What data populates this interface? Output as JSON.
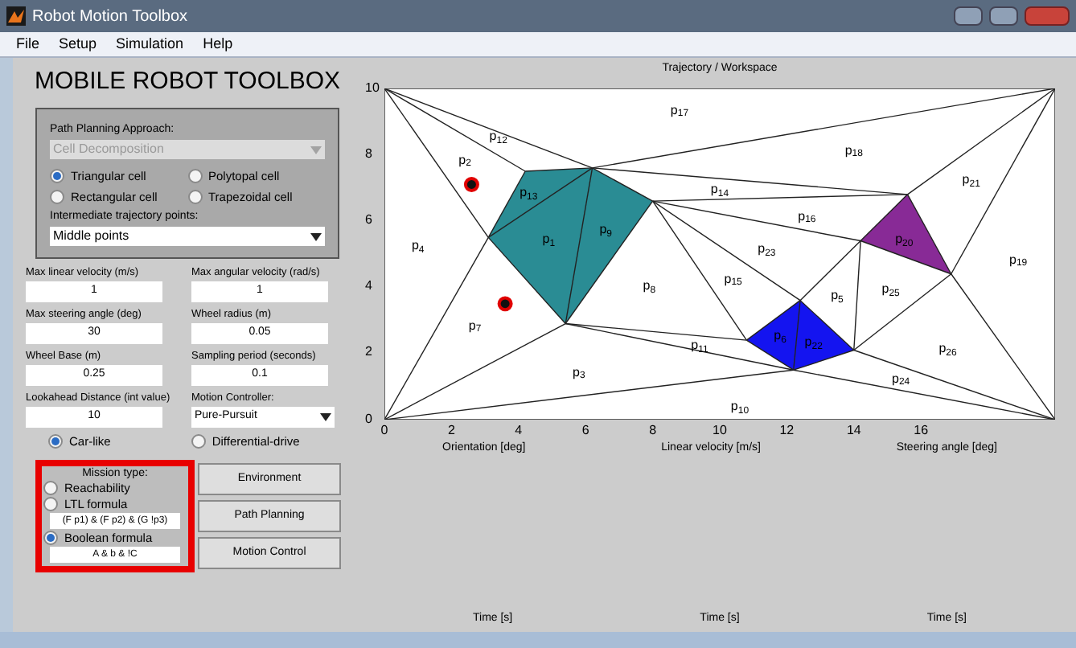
{
  "window": {
    "title": "Robot Motion Toolbox"
  },
  "menu": [
    "File",
    "Setup",
    "Simulation",
    "Help"
  ],
  "heading": "MOBILE ROBOT TOOLBOX",
  "path_planning": {
    "label": "Path Planning Approach:",
    "method": {
      "value": "Cell Decomposition",
      "disabled": true
    },
    "cell_types": [
      {
        "label": "Triangular cell",
        "selected": true
      },
      {
        "label": "Polytopal cell",
        "selected": false
      },
      {
        "label": "Rectangular cell",
        "selected": false
      },
      {
        "label": "Trapezoidal cell",
        "selected": false
      }
    ],
    "intermediate": {
      "label": "Intermediate trajectory points:",
      "value": "Middle points"
    }
  },
  "params": [
    {
      "kind": "field",
      "label": "Max linear velocity (m/s)",
      "value": "1"
    },
    {
      "kind": "field",
      "label": "Max angular velocity (rad/s)",
      "value": "1"
    },
    {
      "kind": "field",
      "label": "Max steering angle (deg)",
      "value": "30"
    },
    {
      "kind": "field",
      "label": "Wheel radius (m)",
      "value": "0.05"
    },
    {
      "kind": "field",
      "label": "Wheel Base (m)",
      "value": "0.25"
    },
    {
      "kind": "field",
      "label": "Sampling period (seconds)",
      "value": "0.1"
    },
    {
      "kind": "field",
      "label": "Lookahead Distance (int value)",
      "value": "10"
    },
    {
      "kind": "select",
      "label": "Motion Controller:",
      "value": "Pure-Pursuit"
    }
  ],
  "drive_types": [
    {
      "label": "Car-like",
      "selected": true
    },
    {
      "label": "Differential-drive",
      "selected": false
    }
  ],
  "mission": {
    "title": "Mission type:",
    "options": [
      {
        "label": "Reachability",
        "selected": false
      },
      {
        "label": "LTL formula",
        "selected": false,
        "formula": "(F p1) & (F p2) & (G !p3)"
      },
      {
        "label": "Boolean formula",
        "selected": true,
        "formula": "A & b & !C"
      }
    ]
  },
  "actions": [
    "Environment",
    "Path Planning",
    "Motion Control"
  ],
  "plot": {
    "title": "Trajectory / Workspace",
    "yticks": [
      "10",
      "8",
      "6",
      "4",
      "2",
      "0"
    ],
    "xticks": [
      "0",
      "2",
      "4",
      "6",
      "8",
      "10",
      "12",
      "14",
      "16"
    ],
    "regions": [
      {
        "label": "p$_{17}$"
      },
      {
        "label": "p$_{12}$"
      },
      {
        "label": "p$_{2}$"
      },
      {
        "label": "p$_{18}$"
      },
      {
        "label": "p$_{13}$",
        "color": "#2a8c94"
      },
      {
        "label": "p$_{14}$"
      },
      {
        "label": "p$_{21}$"
      },
      {
        "label": "p$_{16}$"
      },
      {
        "label": "p$_{1}$",
        "color": "#2a8c94"
      },
      {
        "label": "p$_{9}$",
        "color": "#2a8c94"
      },
      {
        "label": "p$_{20}$",
        "color": "#882a96"
      },
      {
        "label": "p$_{4}$"
      },
      {
        "label": "p$_{23}$"
      },
      {
        "label": "p$_{19}$"
      },
      {
        "label": "p$_{15}$"
      },
      {
        "label": "p$_{8}$"
      },
      {
        "label": "p$_{5}$"
      },
      {
        "label": "p$_{25}$"
      },
      {
        "label": "p$_{7}$"
      },
      {
        "label": "p$_{6}$",
        "color": "#1414f0"
      },
      {
        "label": "p$_{22}$",
        "color": "#1414f0"
      },
      {
        "label": "p$_{11}$"
      },
      {
        "label": "p$_{26}$"
      },
      {
        "label": "p$_{3}$"
      },
      {
        "label": "p$_{24}$"
      },
      {
        "label": "p$_{10}$"
      }
    ],
    "axis_labels": [
      "Orientation [deg]",
      "Linear velocity [m/s]",
      "Steering angle [deg]"
    ],
    "time_labels": [
      "Time [s]",
      "Time [s]",
      "Time [s]"
    ]
  }
}
